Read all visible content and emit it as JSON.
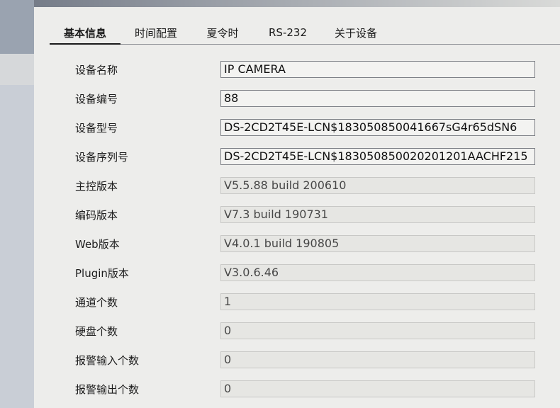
{
  "tabs": [
    {
      "label": "基本信息",
      "active": true
    },
    {
      "label": "时间配置",
      "active": false
    },
    {
      "label": "夏令时",
      "active": false
    },
    {
      "label": "RS-232",
      "active": false
    },
    {
      "label": "关于设备",
      "active": false
    }
  ],
  "fields": [
    {
      "label": "设备名称",
      "value": "IP CAMERA",
      "editable": true
    },
    {
      "label": "设备编号",
      "value": "88",
      "editable": true
    },
    {
      "label": "设备型号",
      "value": "DS-2CD2T45E-LCN$183050850041667sG4r65dSN6",
      "editable": false
    },
    {
      "label": "设备序列号",
      "value": "DS-2CD2T45E-LCN$183050850020201201AACHF215",
      "editable": false
    },
    {
      "label": "主控版本",
      "value": "V5.5.88 build 200610",
      "editable": false
    },
    {
      "label": "编码版本",
      "value": "V7.3 build 190731",
      "editable": false
    },
    {
      "label": "Web版本",
      "value": "V4.0.1 build 190805",
      "editable": false
    },
    {
      "label": "Plugin版本",
      "value": "V3.0.6.46",
      "editable": false
    },
    {
      "label": "通道个数",
      "value": "1",
      "editable": false
    },
    {
      "label": "硬盘个数",
      "value": "0",
      "editable": false
    },
    {
      "label": "报警输入个数",
      "value": "0",
      "editable": false
    },
    {
      "label": "报警输出个数",
      "value": "0",
      "editable": false
    }
  ]
}
